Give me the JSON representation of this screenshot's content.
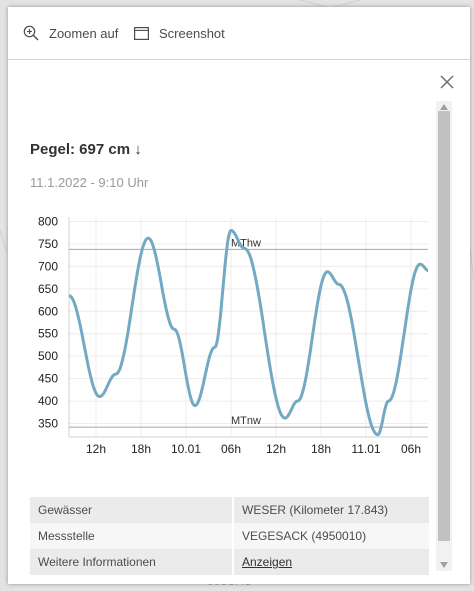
{
  "toolbar": {
    "zoom_label": "Zoomen auf",
    "screenshot_label": "Screenshot"
  },
  "map": {
    "label": "LODZFIE"
  },
  "gauge": {
    "title": "Pegel: 697 cm ↓",
    "timestamp": "11.1.2022 - 9:10 Uhr"
  },
  "chart_data": {
    "type": "line",
    "y_ticks": [
      "800",
      "750",
      "700",
      "650",
      "600",
      "550",
      "500",
      "450",
      "400",
      "350"
    ],
    "x_ticks": [
      "12h",
      "18h",
      "10.01",
      "06h",
      "12h",
      "18h",
      "11.01",
      "06h"
    ],
    "ylim": [
      320,
      810
    ],
    "grid": true,
    "reference_lines": [
      {
        "name": "MThw",
        "value": 738
      },
      {
        "name": "MTnw",
        "value": 342
      }
    ],
    "series": [
      {
        "color": "#74a9c3",
        "points": [
          [
            0.0,
            635
          ],
          [
            3.4,
            410
          ],
          [
            5.2,
            460
          ],
          [
            8.8,
            763
          ],
          [
            11.7,
            560
          ],
          [
            14.0,
            390
          ],
          [
            16.2,
            520
          ],
          [
            18.0,
            780
          ],
          [
            19.5,
            740
          ],
          [
            24.0,
            362
          ],
          [
            25.4,
            400
          ],
          [
            28.7,
            688
          ],
          [
            30.0,
            660
          ],
          [
            34.3,
            325
          ],
          [
            35.5,
            400
          ],
          [
            39.0,
            705
          ],
          [
            40.0,
            690
          ]
        ]
      }
    ]
  },
  "info": {
    "rows": [
      {
        "key": "Gewässer",
        "value": "WESER (Kilometer 17.843)"
      },
      {
        "key": "Messstelle",
        "value": "VEGESACK (4950010)"
      },
      {
        "key": "Weitere Informationen",
        "value": "Anzeigen"
      }
    ]
  }
}
